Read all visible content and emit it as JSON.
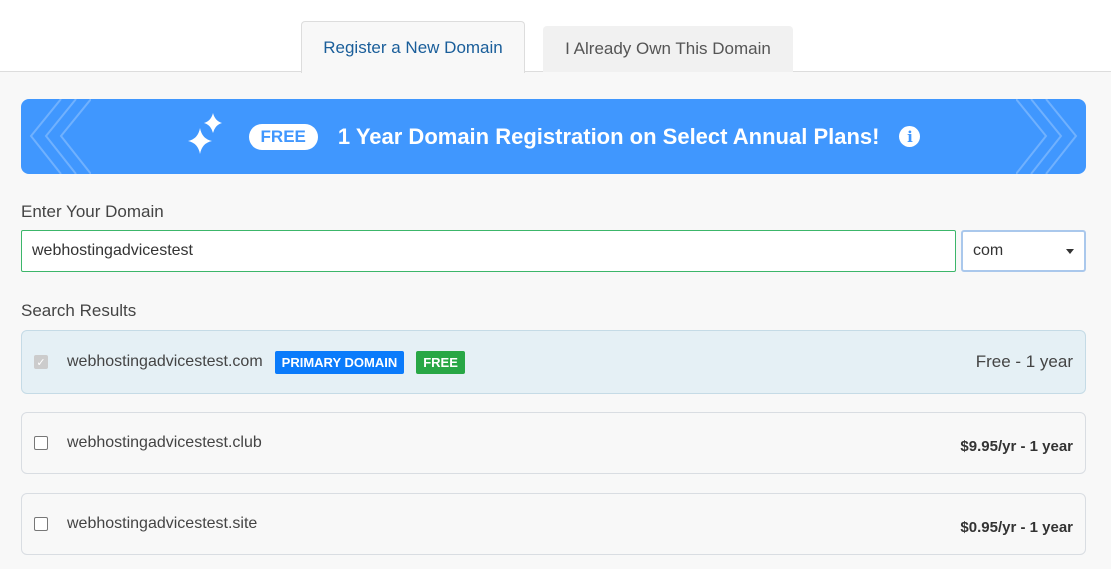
{
  "tabs": [
    {
      "label": "Register a New Domain",
      "active": true
    },
    {
      "label": "I Already Own This Domain",
      "active": false
    }
  ],
  "banner": {
    "badge": "FREE",
    "text": "1 Year Domain Registration on Select Annual Plans!",
    "info_icon": "i",
    "color": "#4097fe"
  },
  "domain_form": {
    "label": "Enter Your Domain",
    "value": "webhostingadvicestest",
    "tld": "com"
  },
  "results": {
    "heading": "Search Results",
    "items": [
      {
        "domain": "webhostingadvicestest.com",
        "checked": true,
        "badges": [
          "PRIMARY DOMAIN",
          "FREE"
        ],
        "price": "Free - 1 year"
      },
      {
        "domain": "webhostingadvicestest.club",
        "checked": false,
        "price": "$9.95/yr - 1 year"
      },
      {
        "domain": "webhostingadvicestest.site",
        "checked": false,
        "price": "$0.95/yr - 1 year"
      }
    ]
  },
  "colors": {
    "primary_badge": "#0a7bfb",
    "free_badge": "#28a745"
  }
}
